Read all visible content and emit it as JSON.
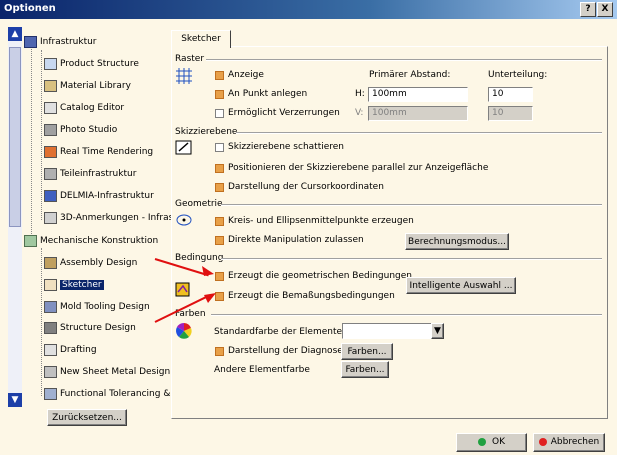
{
  "window": {
    "title": "Optionen",
    "help_btn": "?",
    "close_btn": "X"
  },
  "tree": {
    "items": [
      {
        "label": "Infrastruktur"
      },
      {
        "label": "Product Structure"
      },
      {
        "label": "Material Library"
      },
      {
        "label": "Catalog Editor"
      },
      {
        "label": "Photo Studio"
      },
      {
        "label": "Real Time Rendering"
      },
      {
        "label": "Teileinfrastruktur"
      },
      {
        "label": "DELMIA-Infrastruktur"
      },
      {
        "label": "3D-Anmerkungen - Infras"
      },
      {
        "label": "Mechanische Konstruktion"
      },
      {
        "label": "Assembly Design"
      },
      {
        "label": "Sketcher"
      },
      {
        "label": "Mold Tooling Design"
      },
      {
        "label": "Structure Design"
      },
      {
        "label": "Drafting"
      },
      {
        "label": "New Sheet Metal Design"
      },
      {
        "label": "Functional Tolerancing &"
      }
    ],
    "reset_button": "Zurücksetzen..."
  },
  "tab": {
    "label": "Sketcher"
  },
  "raster": {
    "title": "Raster",
    "anzeige": "Anzeige",
    "primary_spacing": "Primärer Abstand:",
    "division": "Unterteilung:",
    "snap": "An Punkt anlegen",
    "h_label": "H:",
    "h_value": "100mm",
    "h_div": "10",
    "distort": "Ermöglicht Verzerrungen",
    "v_label": "V:",
    "v_value": "100mm",
    "v_div": "10"
  },
  "skizzierebene": {
    "title": "Skizzierebene",
    "shade": "Skizzierebene schattieren",
    "position": "Positionieren der Skizzierebene parallel zur Anzeigefläche",
    "cursor": "Darstellung der Cursorkoordinaten"
  },
  "geometrie": {
    "title": "Geometrie",
    "centers": "Kreis- und Ellipsenmittelpunkte erzeugen",
    "direct": "Direkte Manipulation zulassen",
    "calc_btn": "Berechnungsmodus..."
  },
  "bedingung": {
    "title": "Bedingung",
    "geo": "Erzeugt die geometrischen Bedingungen",
    "dim": "Erzeugt die Bemaßungsbedingungen",
    "smart_btn": "Intelligente Auswahl ..."
  },
  "farben": {
    "title": "Farben",
    "default_color": "Standardfarbe der Elemente",
    "diagnose": "Darstellung der Diagnose",
    "colors_btn1": "Farben...",
    "other": "Andere Elementfarbe",
    "colors_btn2": "Farben..."
  },
  "footer": {
    "ok": "OK",
    "cancel": "Abbrechen"
  },
  "colors": {
    "accent": "#0a246a",
    "checkbox_on": "#e8a048",
    "panel_bg": "#fdf7e6",
    "arrow": "#e01010"
  }
}
